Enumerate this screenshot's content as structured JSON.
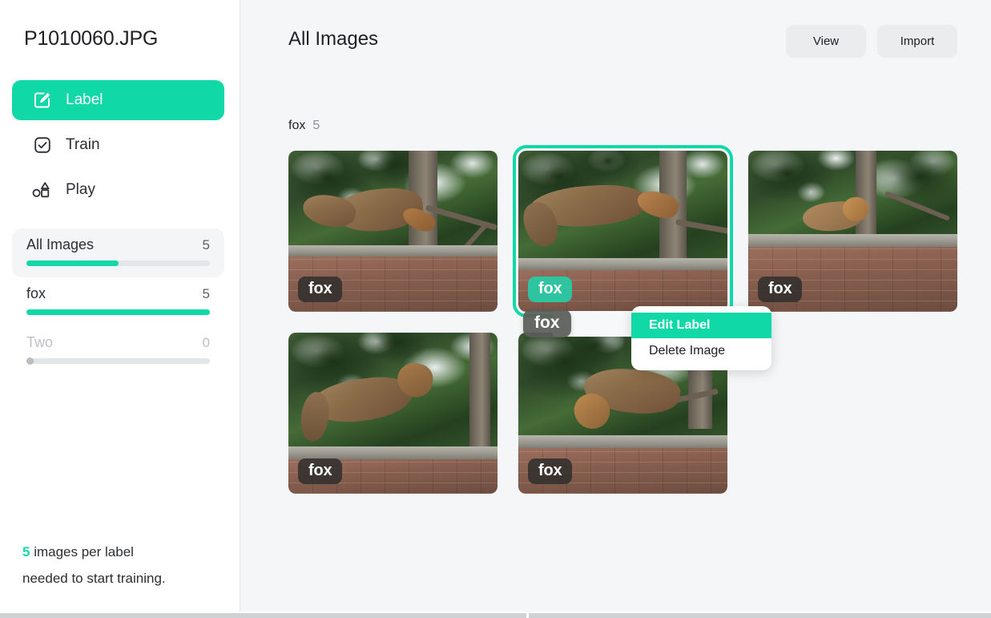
{
  "sidebar": {
    "project_title": "P1010060.JPG",
    "nav": [
      {
        "label": "Label",
        "icon": "pencil-square-icon",
        "active": true
      },
      {
        "label": "Train",
        "icon": "check-square-icon",
        "active": false
      },
      {
        "label": "Play",
        "icon": "shapes-icon",
        "active": false
      }
    ],
    "labels": [
      {
        "name": "All Images",
        "count": "5",
        "fill_percent": 50,
        "selected": true,
        "empty": false
      },
      {
        "name": "fox",
        "count": "5",
        "fill_percent": 100,
        "selected": false,
        "empty": false
      },
      {
        "name": "Two",
        "count": "0",
        "fill_percent": 0,
        "selected": false,
        "empty": true
      }
    ],
    "footnote": {
      "highlight": "5",
      "line1": " images per label",
      "line2": "needed to start training."
    }
  },
  "main": {
    "title": "All Images",
    "buttons": [
      {
        "label": "View",
        "name": "view-button"
      },
      {
        "label": "Import",
        "name": "import-button"
      }
    ],
    "group": {
      "name": "fox",
      "count": "5"
    },
    "cards": [
      {
        "chip": "fox",
        "selected": false,
        "chip_active": false
      },
      {
        "chip": "fox",
        "selected": true,
        "chip_active": true
      },
      {
        "chip": "fox",
        "selected": false,
        "chip_active": false
      },
      {
        "chip": "fox",
        "selected": false,
        "chip_active": false
      },
      {
        "chip": "fox",
        "selected": false,
        "chip_active": false
      }
    ],
    "drag_chip": "fox"
  },
  "context_menu": {
    "items": [
      {
        "label": "Edit Label",
        "highlighted": true
      },
      {
        "label": "Delete Image",
        "highlighted": false
      }
    ]
  },
  "colors": {
    "accent": "#10D9A7",
    "sidebar_bg": "#ffffff",
    "main_bg": "#f5f6f8",
    "chip_bg": "#302e2c",
    "text": "#202124",
    "muted": "#bdc1c6"
  }
}
